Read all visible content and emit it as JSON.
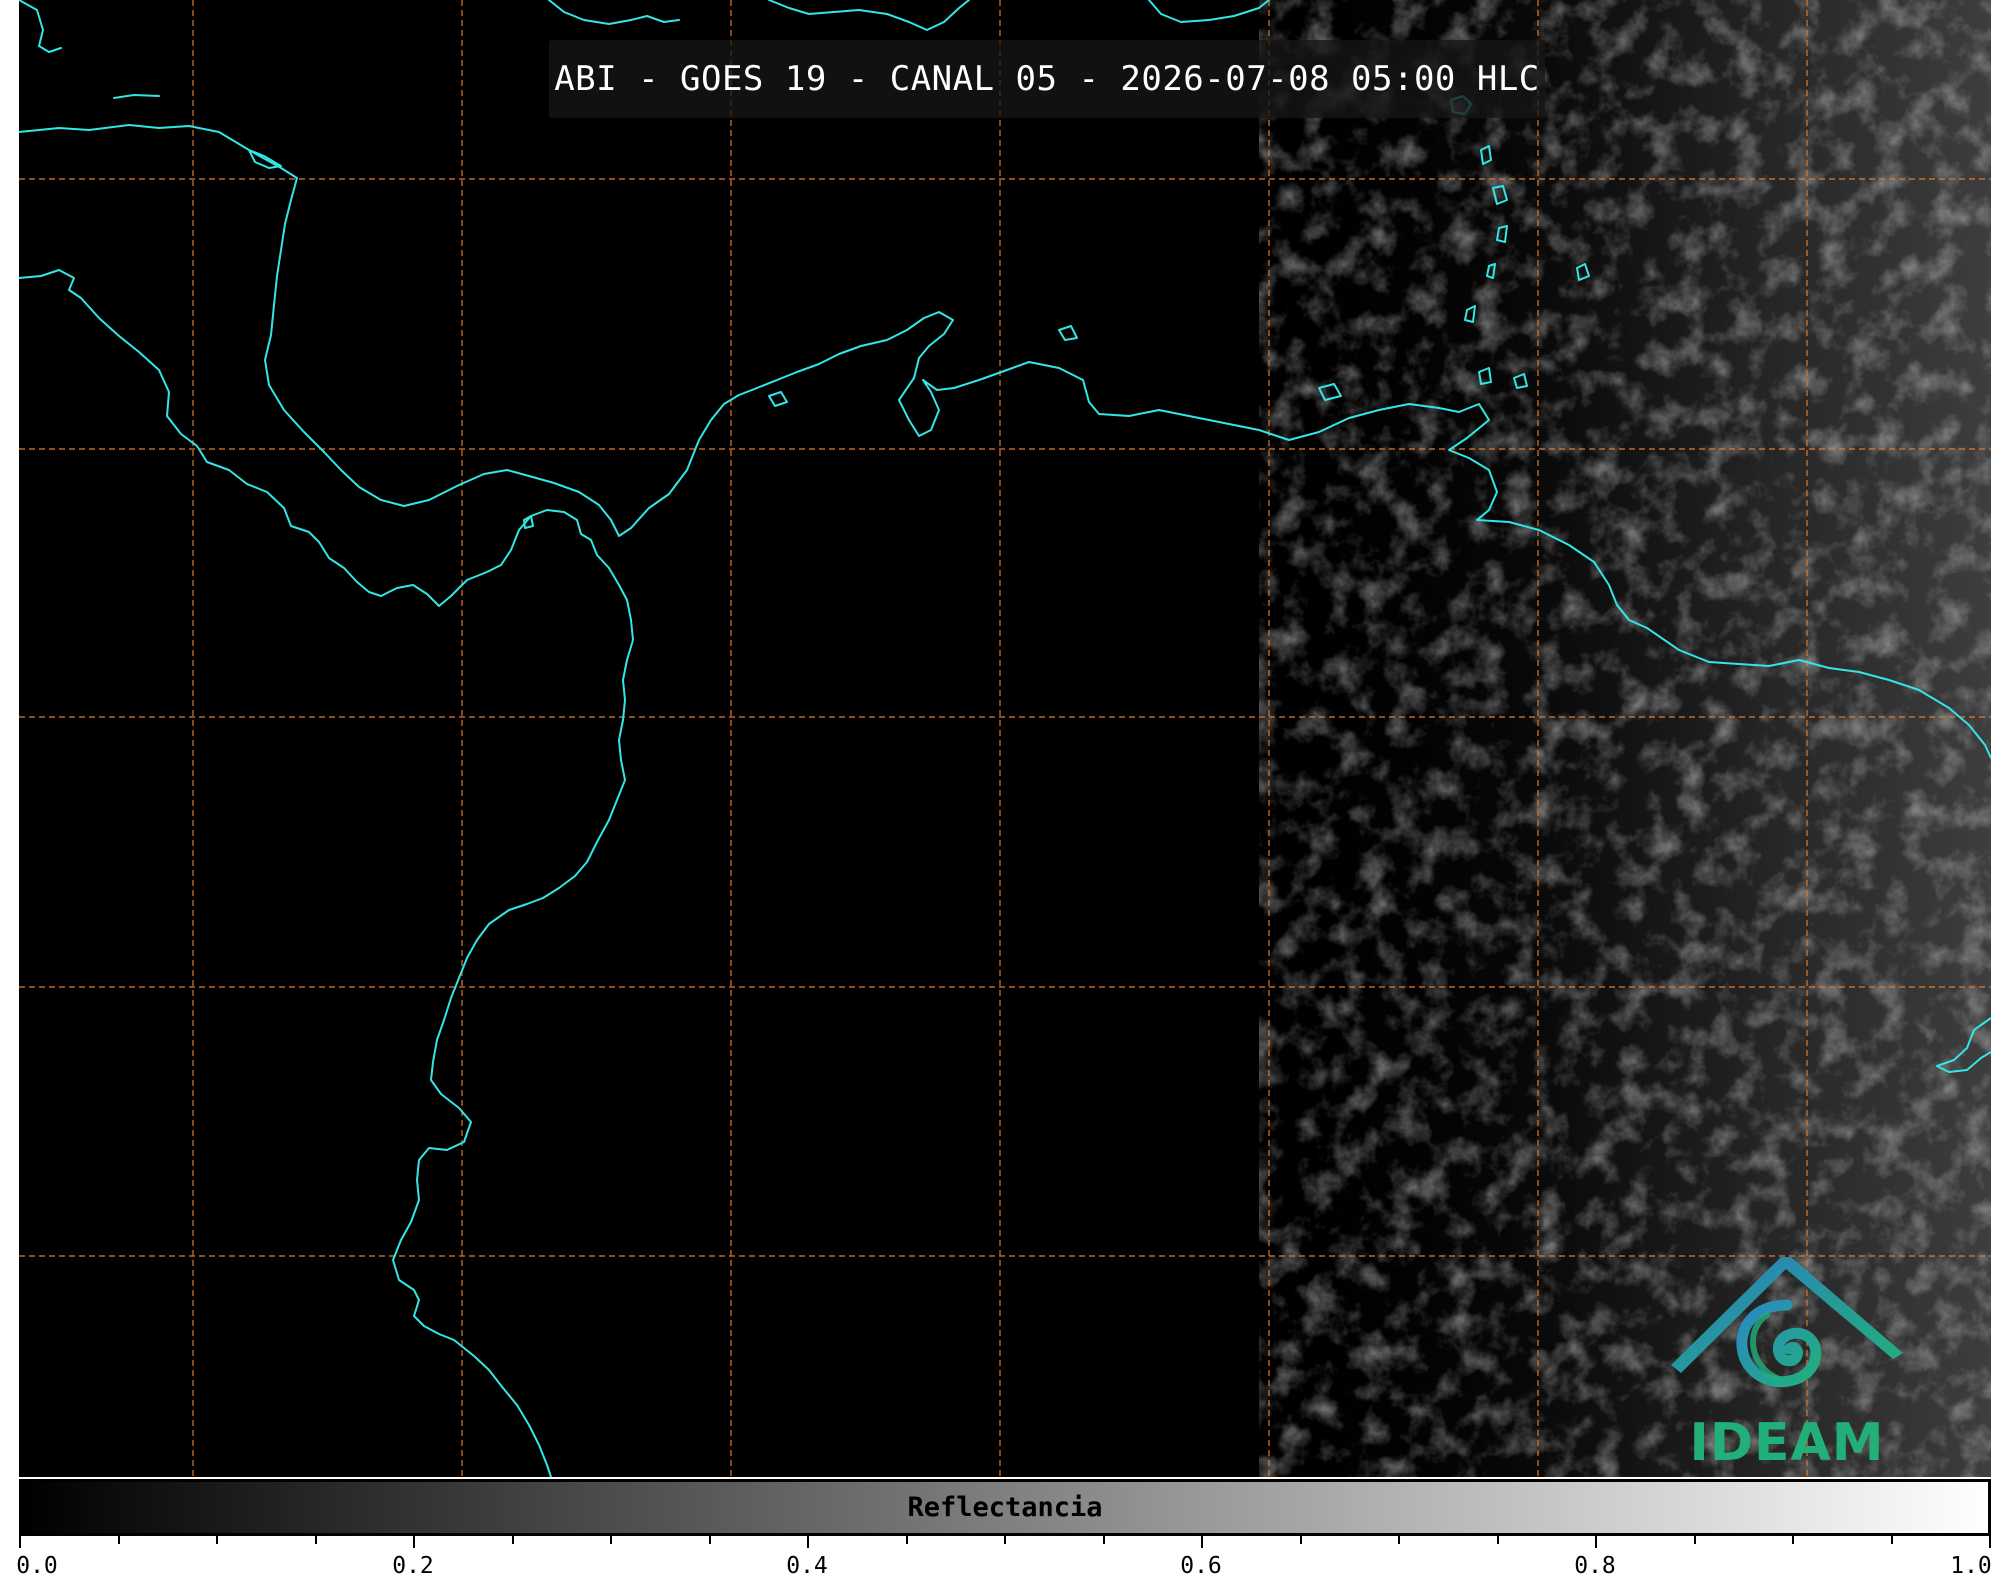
{
  "map": {
    "title": "ABI - GOES 19 - CANAL 05 - 2026-07-08 05:00 HLC",
    "background_color": "#000000",
    "coastline_color": "#33e6e6",
    "gridline_color": "#e07a2a",
    "logo": {
      "icon": "ideam-mountain-swirl-logo",
      "text": "IDEAM",
      "roof_color": "#2a7fc0",
      "swirl_color": "#22b07a"
    }
  },
  "colorbar": {
    "label": "Reflectancia",
    "min": 0.0,
    "max": 1.0,
    "colormap": "grayscale",
    "tick_labels": [
      "0.0",
      "0.2",
      "0.4",
      "0.6",
      "0.8",
      "1.0"
    ]
  }
}
